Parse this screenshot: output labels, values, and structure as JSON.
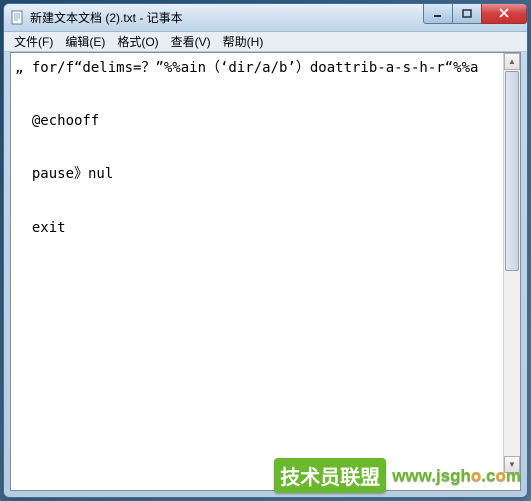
{
  "window": {
    "title": "新建文本文档 (2).txt - 记事本"
  },
  "menu": {
    "file": "文件(F)",
    "edit": "编辑(E)",
    "format": "格式(O)",
    "view": "查看(V)",
    "help": "帮助(H)"
  },
  "editor": {
    "content": "„ for/f“delims=？”%%ain（‘dir/a/b’）doattrib-a-s-h-r“%%a\n\n  @echooff\n\n  pause》nul\n\n  exit"
  },
  "watermark": {
    "badge": "技术员联盟",
    "url_prefix": "www.jsgh",
    "url_o": "o",
    "url_suffix": ".c",
    "url_o2": "o",
    "url_end": "m"
  }
}
